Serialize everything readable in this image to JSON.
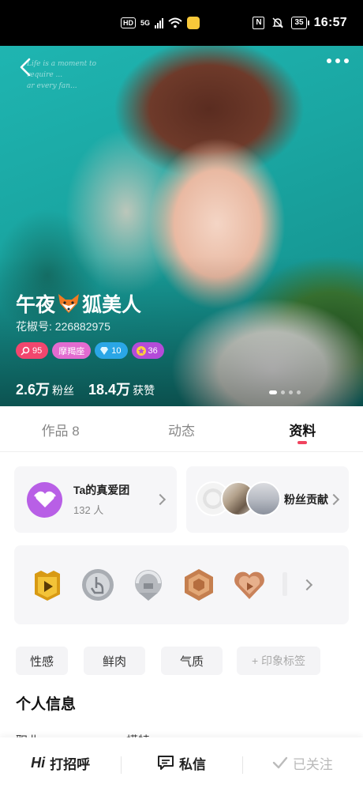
{
  "status_bar": {
    "hd_label": "HD",
    "network_label": "5G",
    "battery_level": "35",
    "time": "16:57",
    "nfc_label": "N"
  },
  "hero": {
    "deco_text_lines": [
      "Life is a moment to",
      "require ...",
      "ar every fan..."
    ],
    "name_part1": "午夜",
    "name_part2": "狐美人",
    "id_line": "花椒号: 226882975",
    "badges": {
      "level": "95",
      "zodiac": "摩羯座",
      "diamond": "10",
      "star": "36"
    },
    "stats": {
      "fans_value": "2.6万",
      "fans_label": "粉丝",
      "likes_value": "18.4万",
      "likes_label": "获赞"
    },
    "page_count": 4,
    "active_page": 0
  },
  "tabs": [
    {
      "label": "作品 8"
    },
    {
      "label": "动态"
    },
    {
      "label": "资料"
    }
  ],
  "fan_club": {
    "title": "Ta的真爱团",
    "count": "132 人"
  },
  "contribution": {
    "label": "粉丝贡献"
  },
  "tags": [
    "性感",
    "鲜肉",
    "气质",
    "+ 印象标签"
  ],
  "personal_info": {
    "title": "个人信息",
    "partial_fields": [
      "职业",
      "模特"
    ]
  },
  "bottom_bar": {
    "greet_label": "打招呼",
    "greet_glyph": "Hi",
    "message_label": "私信",
    "follow_label": "已关注"
  },
  "colors": {
    "accent": "#f0435e",
    "fan_club_purple": "#b85fe6",
    "level_badge": "#f2466e",
    "zodiac_badge": "#e36bd0",
    "diamond_badge": "#2aa6e6",
    "star_badge": "#b44bd8"
  }
}
